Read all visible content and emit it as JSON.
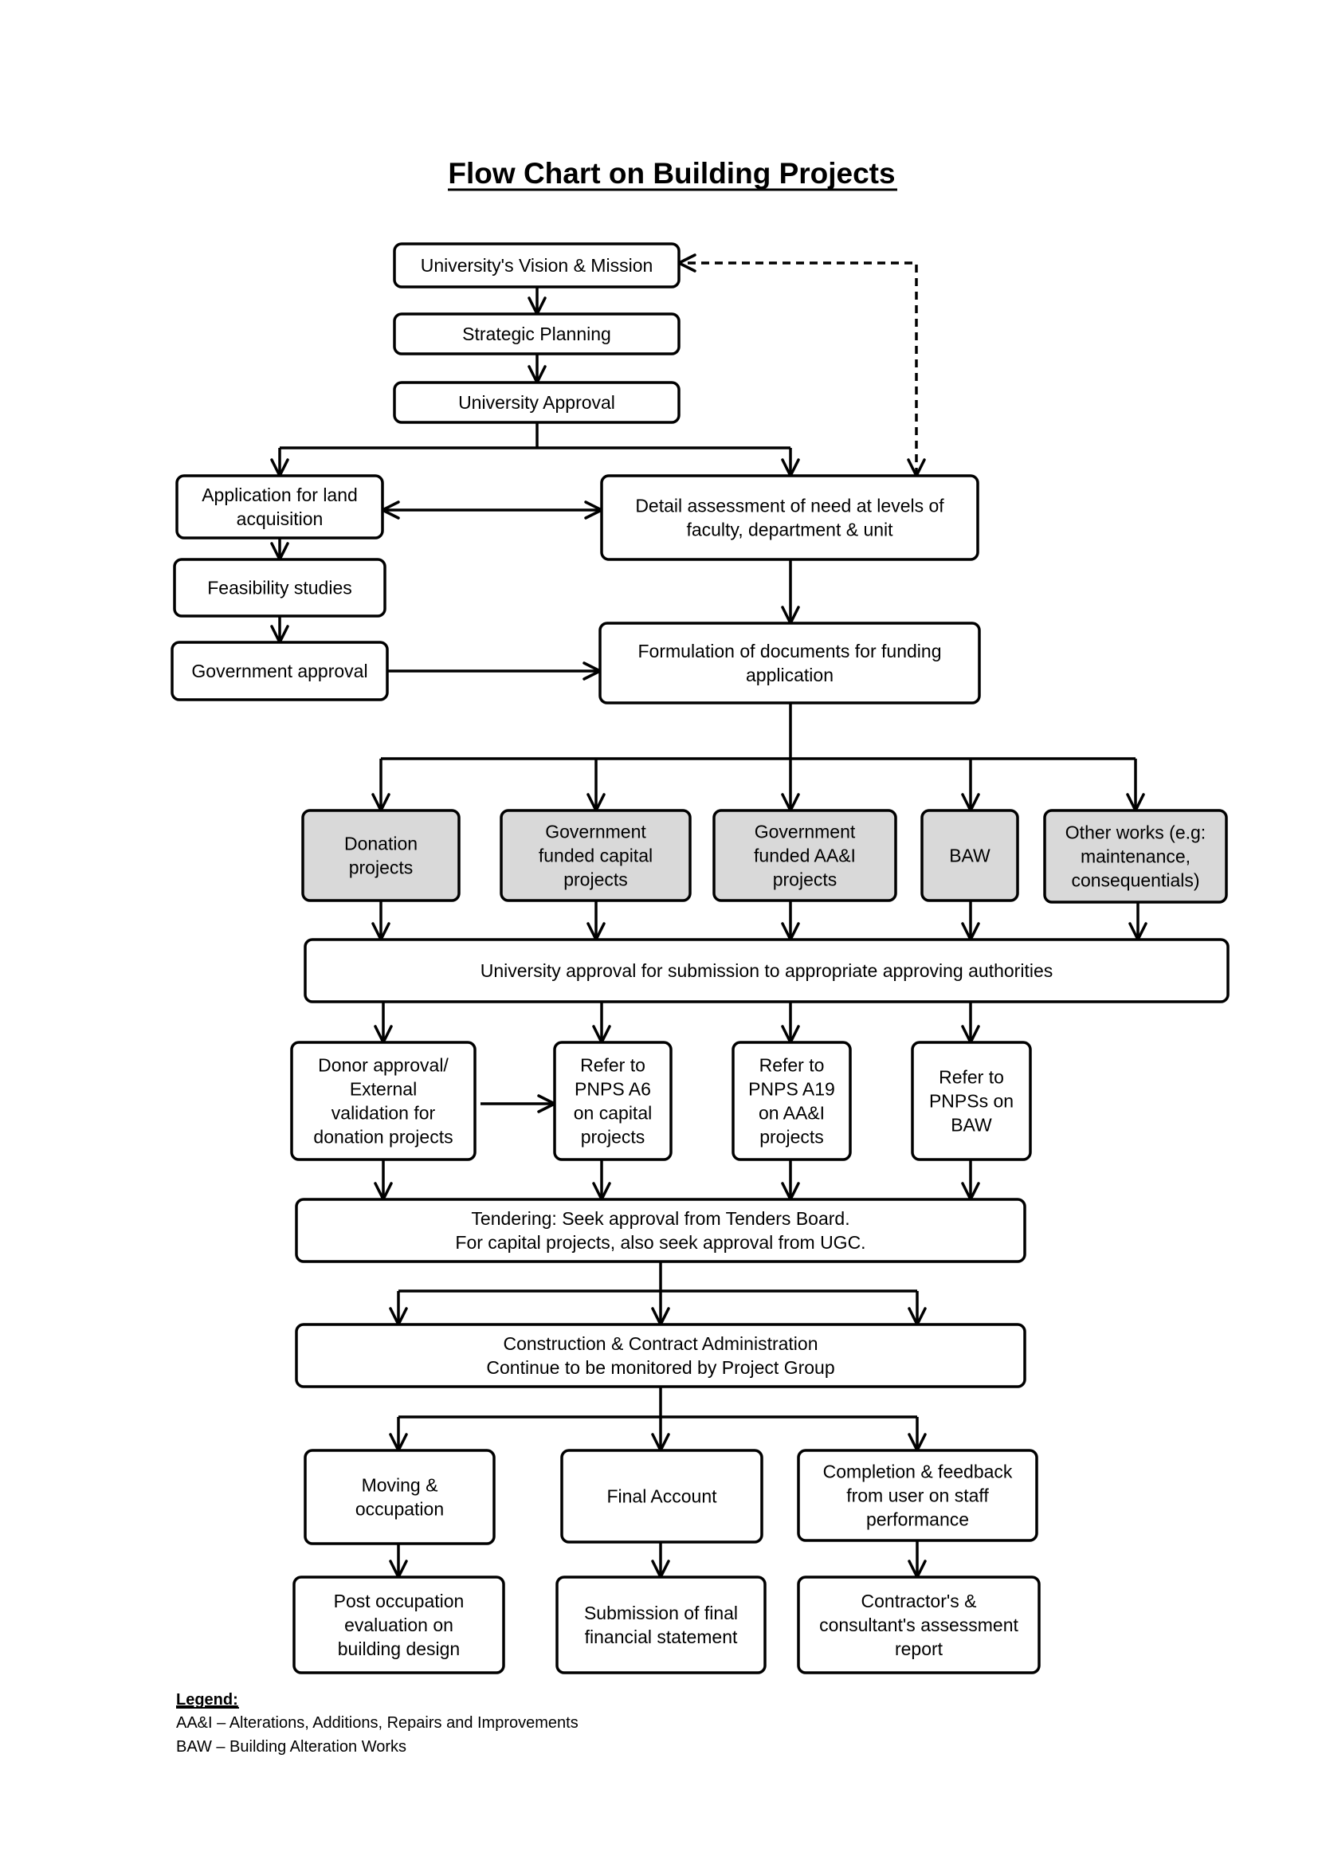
{
  "title": "Flow Chart on Building Projects",
  "colors": {
    "stroke": "#000000",
    "box_fill": "#ffffff",
    "funding_box_fill": "#d9d9d9",
    "background": "#ffffff"
  },
  "nodes": [
    {
      "id": "vision",
      "lines": [
        "University's Vision & Mission"
      ],
      "shaded": false
    },
    {
      "id": "strategic",
      "lines": [
        "Strategic Planning"
      ],
      "shaded": false
    },
    {
      "id": "univ_approval",
      "lines": [
        "University Approval"
      ],
      "shaded": false
    },
    {
      "id": "land",
      "lines": [
        "Application for land",
        "acquisition"
      ],
      "shaded": false
    },
    {
      "id": "feasibility",
      "lines": [
        "Feasibility studies"
      ],
      "shaded": false
    },
    {
      "id": "gov_approval",
      "lines": [
        "Government approval"
      ],
      "shaded": false
    },
    {
      "id": "detail",
      "lines": [
        "Detail assessment of need at levels of",
        "faculty, department & unit"
      ],
      "shaded": false
    },
    {
      "id": "formulation",
      "lines": [
        "Formulation of documents for funding",
        "application"
      ],
      "shaded": false
    },
    {
      "id": "donation",
      "lines": [
        "Donation",
        "projects"
      ],
      "shaded": true
    },
    {
      "id": "gov_capital",
      "lines": [
        "Government",
        "funded capital",
        "projects"
      ],
      "shaded": true
    },
    {
      "id": "gov_aai",
      "lines": [
        "Government",
        "funded AA&I",
        "projects"
      ],
      "shaded": true
    },
    {
      "id": "baw",
      "lines": [
        "BAW"
      ],
      "shaded": true
    },
    {
      "id": "other",
      "lines": [
        "Other works (e.g:",
        "maintenance,",
        "consequentials)"
      ],
      "shaded": true
    },
    {
      "id": "submission_approval",
      "lines": [
        "University approval for submission to appropriate approving authorities"
      ],
      "shaded": false
    },
    {
      "id": "donor",
      "lines": [
        "Donor approval/",
        "External",
        "validation for",
        "donation projects"
      ],
      "shaded": false
    },
    {
      "id": "pnps_a6",
      "lines": [
        "Refer to",
        "PNPS A6",
        "on capital",
        "projects"
      ],
      "shaded": false
    },
    {
      "id": "pnps_a19",
      "lines": [
        "Refer to",
        "PNPS A19",
        "on AA&I",
        "projects"
      ],
      "shaded": false
    },
    {
      "id": "pnps_baw",
      "lines": [
        "Refer to",
        "PNPSs on",
        "BAW"
      ],
      "shaded": false
    },
    {
      "id": "tendering",
      "lines": [
        "Tendering: Seek approval from Tenders Board.",
        "For capital projects, also seek approval from UGC."
      ],
      "shaded": false
    },
    {
      "id": "construction",
      "lines": [
        "Construction & Contract Administration",
        "Continue to be monitored by Project Group"
      ],
      "shaded": false
    },
    {
      "id": "moving",
      "lines": [
        "Moving &",
        "occupation"
      ],
      "shaded": false
    },
    {
      "id": "final_account",
      "lines": [
        "Final Account"
      ],
      "shaded": false
    },
    {
      "id": "completion",
      "lines": [
        "Completion & feedback",
        "from user on staff",
        "performance"
      ],
      "shaded": false
    },
    {
      "id": "post_occupation",
      "lines": [
        "Post occupation",
        "evaluation on",
        "building design"
      ],
      "shaded": false
    },
    {
      "id": "final_statement",
      "lines": [
        "Submission of final",
        "financial statement"
      ],
      "shaded": false
    },
    {
      "id": "assessment_report",
      "lines": [
        "Contractor's &",
        "consultant's assessment",
        "report"
      ],
      "shaded": false
    }
  ],
  "edges": [
    {
      "from": "vision",
      "to": "strategic",
      "style": "solid"
    },
    {
      "from": "strategic",
      "to": "univ_approval",
      "style": "solid"
    },
    {
      "from": "univ_approval",
      "to": "land",
      "style": "solid"
    },
    {
      "from": "univ_approval",
      "to": "detail",
      "style": "solid"
    },
    {
      "from": "land",
      "to": "detail",
      "style": "solid",
      "bidirectional": true
    },
    {
      "from": "detail",
      "to": "vision",
      "style": "dashed",
      "bidirectional": true
    },
    {
      "from": "land",
      "to": "feasibility",
      "style": "solid"
    },
    {
      "from": "feasibility",
      "to": "gov_approval",
      "style": "solid"
    },
    {
      "from": "gov_approval",
      "to": "formulation",
      "style": "solid"
    },
    {
      "from": "detail",
      "to": "formulation",
      "style": "solid"
    },
    {
      "from": "formulation",
      "to": "donation",
      "style": "solid"
    },
    {
      "from": "formulation",
      "to": "gov_capital",
      "style": "solid"
    },
    {
      "from": "formulation",
      "to": "gov_aai",
      "style": "solid"
    },
    {
      "from": "formulation",
      "to": "baw",
      "style": "solid"
    },
    {
      "from": "formulation",
      "to": "other",
      "style": "solid"
    },
    {
      "from": "donation",
      "to": "submission_approval",
      "style": "solid"
    },
    {
      "from": "gov_capital",
      "to": "submission_approval",
      "style": "solid"
    },
    {
      "from": "gov_aai",
      "to": "submission_approval",
      "style": "solid"
    },
    {
      "from": "baw",
      "to": "submission_approval",
      "style": "solid"
    },
    {
      "from": "other",
      "to": "submission_approval",
      "style": "solid"
    },
    {
      "from": "submission_approval",
      "to": "donor",
      "style": "solid"
    },
    {
      "from": "submission_approval",
      "to": "pnps_a6",
      "style": "solid"
    },
    {
      "from": "submission_approval",
      "to": "pnps_a19",
      "style": "solid"
    },
    {
      "from": "submission_approval",
      "to": "pnps_baw",
      "style": "solid"
    },
    {
      "from": "donor",
      "to": "pnps_a6",
      "style": "solid"
    },
    {
      "from": "donor",
      "to": "tendering",
      "style": "solid"
    },
    {
      "from": "pnps_a6",
      "to": "tendering",
      "style": "solid"
    },
    {
      "from": "pnps_a19",
      "to": "tendering",
      "style": "solid"
    },
    {
      "from": "pnps_baw",
      "to": "tendering",
      "style": "solid"
    },
    {
      "from": "tendering",
      "to": "construction",
      "style": "solid"
    },
    {
      "from": "construction",
      "to": "moving",
      "style": "solid"
    },
    {
      "from": "construction",
      "to": "final_account",
      "style": "solid"
    },
    {
      "from": "construction",
      "to": "completion",
      "style": "solid"
    },
    {
      "from": "moving",
      "to": "post_occupation",
      "style": "solid"
    },
    {
      "from": "final_account",
      "to": "final_statement",
      "style": "solid"
    },
    {
      "from": "completion",
      "to": "assessment_report",
      "style": "solid"
    }
  ],
  "legend": {
    "heading": "Legend:",
    "items": [
      "AA&I – Alterations, Additions, Repairs and Improvements",
      "BAW – Building Alteration Works"
    ]
  }
}
